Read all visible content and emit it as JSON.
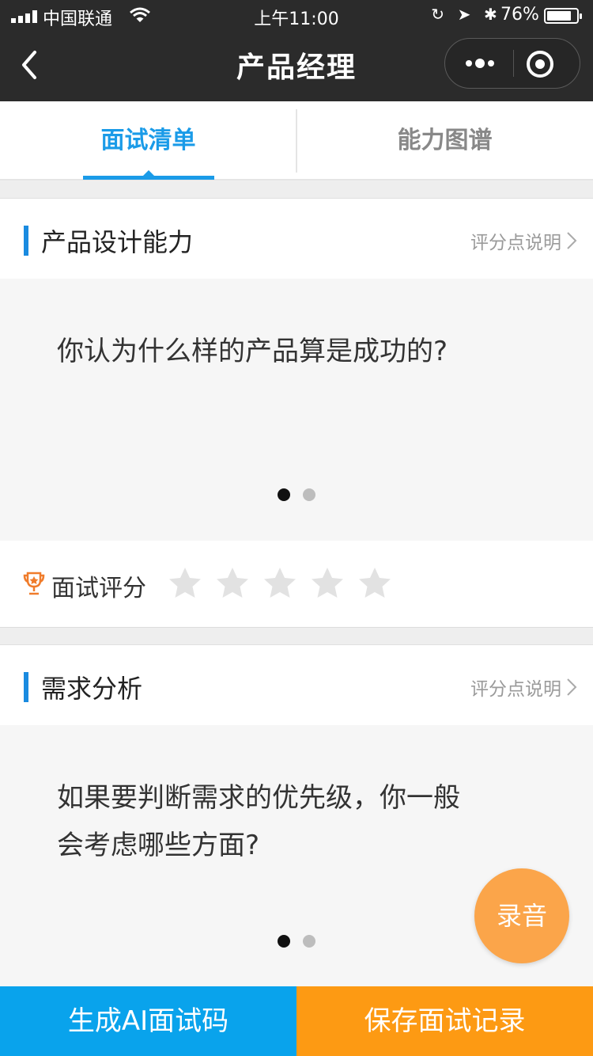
{
  "status_bar": {
    "carrier": "中国联通",
    "time": "上午11:00",
    "battery": "76%"
  },
  "nav": {
    "title": "产品经理"
  },
  "tabs": [
    {
      "label": "面试清单",
      "active": true
    },
    {
      "label": "能力图谱",
      "active": false
    }
  ],
  "sections": [
    {
      "title": "产品设计能力",
      "score_link": "评分点说明",
      "question_line1": "你认为什么样的产品算是成功的?",
      "question_line2": "",
      "page_current": 1,
      "page_total": 2,
      "rating_label": "面试评分",
      "rating": 0,
      "rating_max": 5
    },
    {
      "title": "需求分析",
      "score_link": "评分点说明",
      "question_line1": "如果要判断需求的优先级，你一般",
      "question_line2": "会考虑哪些方面?",
      "page_current": 1,
      "page_total": 2
    }
  ],
  "fab": {
    "label": "录音"
  },
  "bottom_bar": {
    "left_label": "生成AI面试码",
    "right_label": "保存面试记录"
  },
  "colors": {
    "accent_blue": "#1a9be8",
    "button_blue": "#09a3ec",
    "button_orange": "#fd9a13",
    "fab_orange": "#fba54a",
    "trophy_orange": "#f07c2b"
  }
}
